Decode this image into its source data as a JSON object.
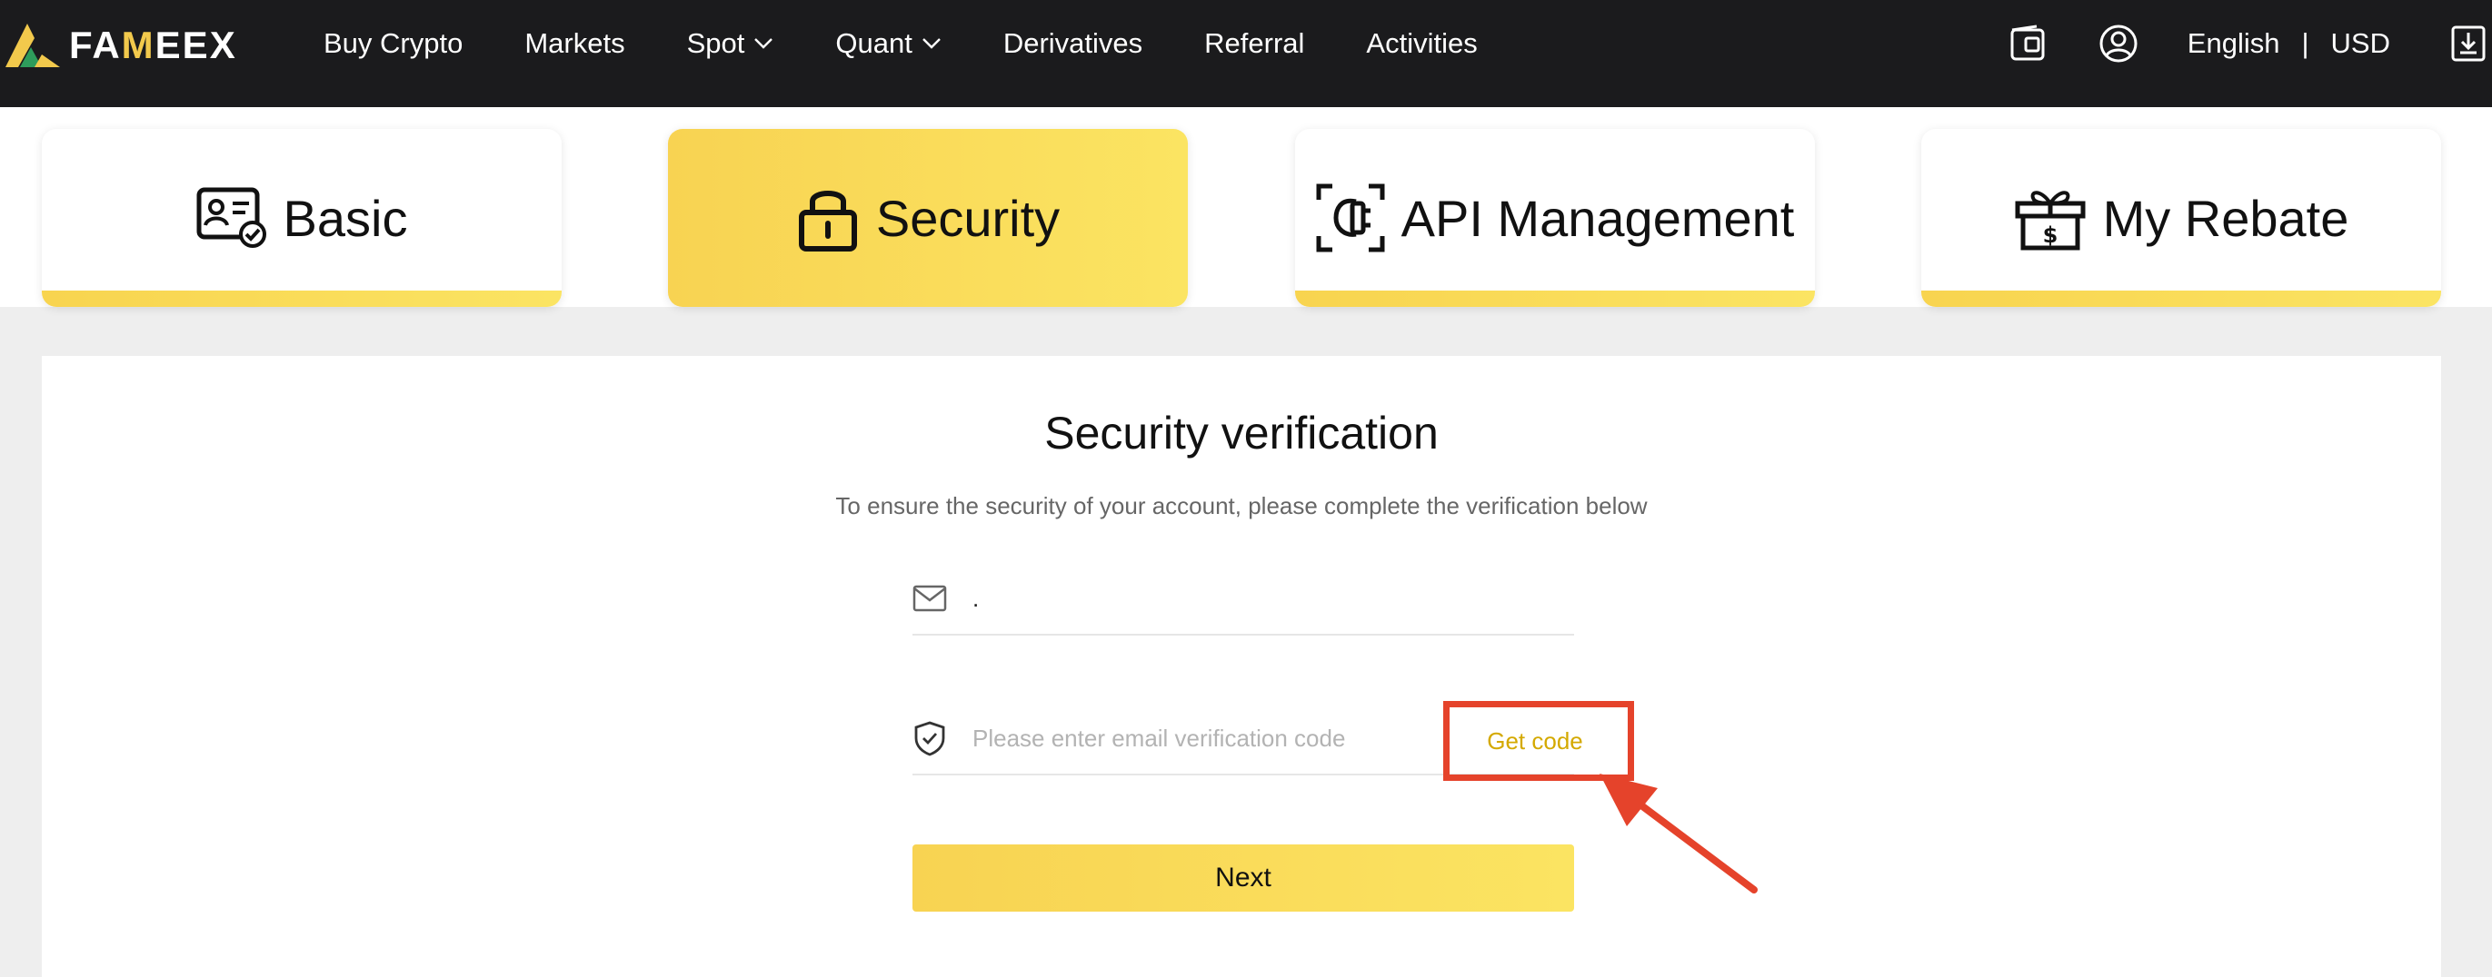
{
  "brand": {
    "logo_text_a": "FA",
    "logo_text_b": "M",
    "logo_text_c": "EEX",
    "accent": "#f8d44f",
    "highlight": "#e5432b"
  },
  "nav": {
    "items": [
      {
        "label": "Buy Crypto",
        "dropdown": false
      },
      {
        "label": "Markets",
        "dropdown": false
      },
      {
        "label": "Spot",
        "dropdown": true
      },
      {
        "label": "Quant",
        "dropdown": true
      },
      {
        "label": "Derivatives",
        "dropdown": false
      },
      {
        "label": "Referral",
        "dropdown": false
      },
      {
        "label": "Activities",
        "dropdown": false
      }
    ],
    "language": "English",
    "separator": "|",
    "currency": "USD",
    "icons": [
      "wallet-icon",
      "user-account-icon",
      "download-icon"
    ]
  },
  "tabs": [
    {
      "label": "Basic",
      "icon": "id-card-check-icon",
      "active": false
    },
    {
      "label": "Security",
      "icon": "lock-icon",
      "active": true
    },
    {
      "label": "API Management",
      "icon": "api-plug-icon",
      "active": false
    },
    {
      "label": "My Rebate",
      "icon": "gift-dollar-icon",
      "active": false
    }
  ],
  "verification": {
    "title": "Security verification",
    "subtitle": "To ensure the security of your account, please complete the verification below",
    "email_value": ".",
    "code_placeholder": "Please enter email verification code",
    "get_code_label": "Get code",
    "next_label": "Next"
  }
}
